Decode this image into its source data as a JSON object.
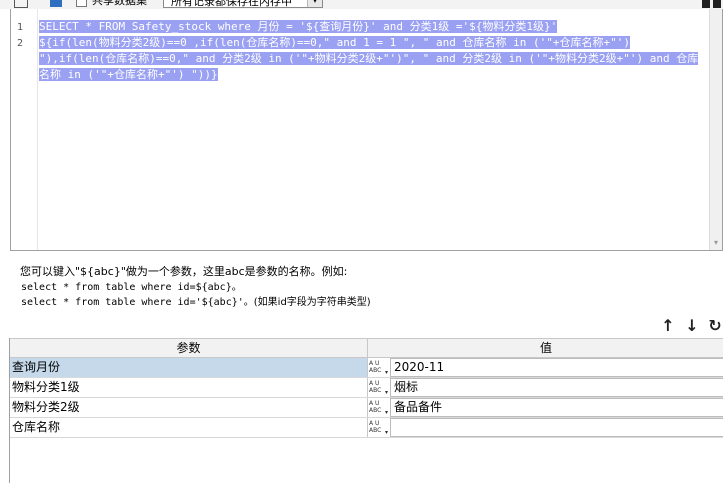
{
  "toolbar": {
    "share_dataset_label": "共享数据集",
    "save_mode_value": "所有记录都保存在内存中",
    "save_mode_arrow": "▾"
  },
  "editor": {
    "line_numbers": [
      "1",
      "2"
    ],
    "lines": [
      " SELECT * FROM Safety_stock   where 月份 = '${查询月份}' and 分类1级  ='${物料分类1级}'",
      " ${if(len(物料分类2级)==0 ,if(len(仓库名称)==0,\" and 1 = 1 \", \" and 仓库名称  in  ('\"+仓库名称+\"') \"),if(len(仓库名称)==0,\" and 分类2级  in  ('\"+物料分类2级+\"')\", \" and 分类2级  in  ('\"+物料分类2级+\"')  and 仓库名称  in  ('\"+仓库名称+\"') \"))}"
    ]
  },
  "hint": {
    "text": "您可以键入\"${abc}\"做为一个参数，这里abc是参数的名称。例如:",
    "example1": "select * from table where id=${abc}。",
    "example2_code": "select * from table where id='${abc}'",
    "example2_note": "。(如果id字段为字符串类型)"
  },
  "actions": {
    "up_icon": "↑",
    "down_icon": "↓",
    "refresh_icon": "↻"
  },
  "params": {
    "header_param": "参数",
    "header_value": "值",
    "type_label": "A U\nABC",
    "rows": [
      {
        "name": "查询月份",
        "value": "2020-11"
      },
      {
        "name": "物料分类1级",
        "value": "烟标"
      },
      {
        "name": "物料分类2级",
        "value": "备品备件"
      },
      {
        "name": "仓库名称",
        "value": ""
      }
    ]
  }
}
